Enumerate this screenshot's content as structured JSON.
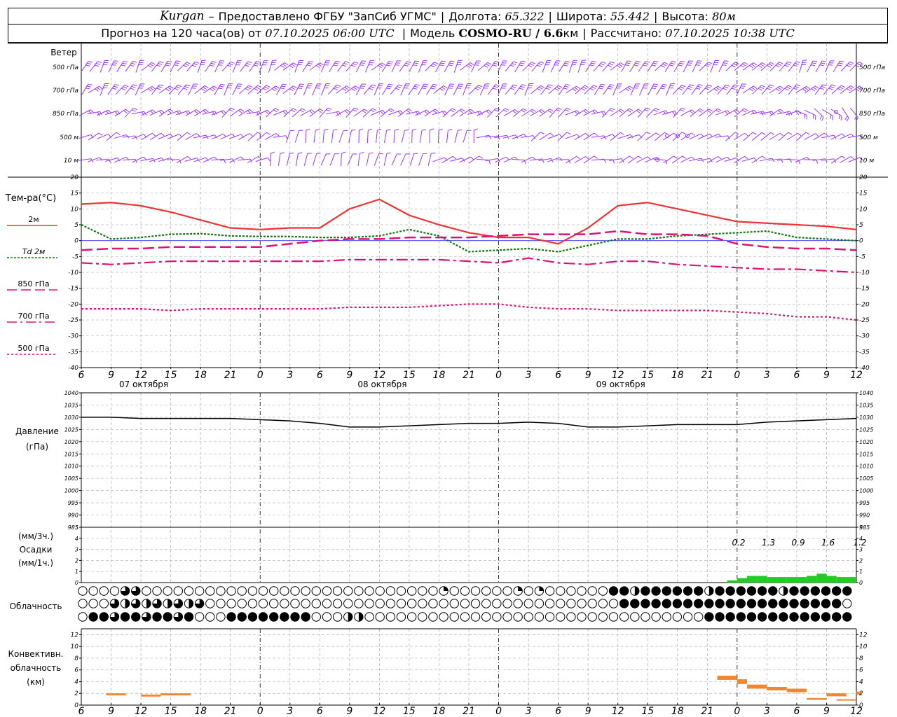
{
  "header": {
    "station": "Kurgan",
    "dash": "–",
    "provider": "Предоставлено ФГБУ \"ЗапСиб УГМС\"",
    "lon_label": "Долгота:",
    "lon": "65.322",
    "lat_label": "Широта:",
    "lat": "55.442",
    "alt_label": "Высота:",
    "alt": "80м",
    "forecast_text": "Прогноз на 120 часа(ов) от",
    "forecast_start": "07.10.2025 06:00 UTC",
    "model_label": "Модель",
    "model": "COSMO-RU / 6.6",
    "model_unit": "км",
    "calc_label": "Рассчитано:",
    "calc_time": "07.10.2025 10:38 UTC"
  },
  "wind": {
    "title": "Ветер",
    "levels": [
      "500 гПа",
      "700 гПа",
      "850 гПа",
      "500 м",
      "10 м"
    ],
    "color": "#9933ff"
  },
  "time_axis": {
    "ticks": [
      "6",
      "9",
      "12",
      "15",
      "18",
      "21",
      "0",
      "3",
      "6",
      "9",
      "12",
      "15",
      "18",
      "21",
      "0",
      "3",
      "6",
      "9",
      "12",
      "15",
      "18",
      "21",
      "0",
      "3",
      "6",
      "9",
      "12"
    ],
    "dates": [
      "07 октября",
      "08 октября",
      "09 октября"
    ]
  },
  "temperature": {
    "title": "Тем-ра(°С)",
    "legend": [
      "2м",
      "Td  2м",
      "850 гПа",
      "700 гПа",
      "500 гПа"
    ],
    "y_ticks": [
      "20",
      "15",
      "10",
      "5",
      "0",
      "-5",
      "-10",
      "-15",
      "-20",
      "-25",
      "-30",
      "-35",
      "-40"
    ]
  },
  "pressure": {
    "title": "Давление",
    "unit": "(гПа)",
    "y_ticks": [
      "1040",
      "1035",
      "1030",
      "1025",
      "1020",
      "1015",
      "1010",
      "1005",
      "1000",
      "995",
      "990",
      "985"
    ]
  },
  "precip": {
    "unit_3h": "(мм/3ч.)",
    "title": "Осадки",
    "unit_1h": "(мм/1ч.)",
    "y_ticks": [
      "5",
      "4",
      "3",
      "2",
      "1",
      "0"
    ],
    "totals": [
      "0.2",
      "1.3",
      "0.9",
      "1.6",
      "1.2"
    ]
  },
  "cloud": {
    "title": "Облачность"
  },
  "convective": {
    "title_line1": "Конвективн.",
    "title_line2": "облачность",
    "title_line3": "(км)",
    "y_ticks": [
      "12",
      "10",
      "8",
      "6",
      "4",
      "2",
      "0"
    ]
  },
  "colors": {
    "t2m": "#ee3333",
    "td2m": "#117711",
    "t850": "#dd1177",
    "t700": "#dd1177",
    "t500": "#dd1177",
    "precip": "#22cc22",
    "convective": "#ee8833",
    "wind": "#9933ff"
  },
  "chart_data": [
    {
      "type": "line",
      "name": "temperature",
      "x_hours": [
        6,
        9,
        12,
        15,
        18,
        21,
        24,
        27,
        30,
        33,
        36,
        39,
        42,
        45,
        48,
        51,
        54,
        57,
        60,
        63,
        66,
        69,
        72,
        75,
        78,
        81,
        84
      ],
      "series": [
        {
          "name": "2м",
          "values": [
            11.5,
            12,
            11,
            9,
            6.5,
            4,
            3.5,
            4,
            4,
            10,
            13,
            8,
            5,
            2.5,
            1,
            1,
            -1,
            4,
            11,
            12,
            10,
            8,
            6,
            5.5,
            5,
            4.5,
            3.5
          ]
        },
        {
          "name": "Td  2м",
          "values": [
            5,
            0.5,
            1,
            2,
            2.2,
            1.5,
            1.3,
            1.3,
            1,
            1,
            1.5,
            3.5,
            1.5,
            -3.5,
            -3,
            -2.5,
            -3.5,
            -1.5,
            0.5,
            0.5,
            1.5,
            2,
            2.5,
            3,
            1,
            0.5,
            0
          ]
        },
        {
          "name": "850 гПа",
          "values": [
            -3,
            -2.5,
            -2.5,
            -2,
            -2,
            -2,
            -2,
            -1,
            0,
            0.5,
            0.5,
            1,
            1,
            1,
            1.5,
            2,
            2,
            2,
            3,
            2,
            2,
            1.5,
            -1,
            -2,
            -2.5,
            -2.5,
            -3
          ]
        },
        {
          "name": "700 гПа",
          "values": [
            -7,
            -7.5,
            -7,
            -6.5,
            -6.5,
            -6.5,
            -6.5,
            -6.5,
            -6.5,
            -6,
            -6,
            -6,
            -6,
            -6.5,
            -7,
            -5.5,
            -7,
            -7.5,
            -6.5,
            -6.5,
            -7.5,
            -8,
            -8.5,
            -9,
            -9,
            -9.5,
            -10
          ]
        },
        {
          "name": "500 гПа",
          "values": [
            -21.5,
            -21.5,
            -21.5,
            -22,
            -21.5,
            -21.5,
            -21.5,
            -21.5,
            -21.5,
            -21,
            -21,
            -21,
            -20.5,
            -20,
            -20,
            -21,
            -21.5,
            -21.5,
            -22,
            -22,
            -22,
            -22,
            -22.5,
            -23,
            -24,
            -24,
            -25
          ]
        }
      ],
      "ylim": [
        -40,
        20
      ]
    },
    {
      "type": "line",
      "name": "pressure",
      "x_hours": [
        6,
        9,
        12,
        15,
        18,
        21,
        24,
        27,
        30,
        33,
        36,
        39,
        42,
        45,
        48,
        51,
        54,
        57,
        60,
        63,
        66,
        69,
        72,
        75,
        78,
        81,
        84
      ],
      "series": [
        {
          "values": [
            1030,
            1030,
            1029.5,
            1029.5,
            1029.5,
            1029.5,
            1029,
            1028.5,
            1027.5,
            1026,
            1026,
            1026.5,
            1027,
            1027.5,
            1027.5,
            1028,
            1027.5,
            1026,
            1026,
            1026.5,
            1027,
            1027,
            1027,
            1028,
            1028.5,
            1029,
            1029.5
          ]
        }
      ],
      "ylim": [
        985,
        1040
      ]
    },
    {
      "type": "bar",
      "name": "precipitation",
      "x_hours": [
        72,
        73,
        74,
        75,
        76,
        77,
        78,
        79,
        80,
        81,
        82,
        83,
        84
      ],
      "values": [
        0.2,
        0.4,
        0.6,
        0.6,
        0.5,
        0.5,
        0.5,
        0.5,
        0.6,
        0.8,
        0.6,
        0.5,
        0.5
      ],
      "ylim": [
        0,
        5
      ]
    },
    {
      "type": "bar",
      "name": "convective_clouds",
      "segments": [
        {
          "x0": 8.5,
          "x1": 10.5,
          "top": 2
        },
        {
          "x0": 12,
          "x1": 14,
          "top": 1.8
        },
        {
          "x0": 14,
          "x1": 17,
          "top": 2
        },
        {
          "x0": 70,
          "x1": 72,
          "top": 5,
          "bottom": 4.3
        },
        {
          "x0": 72,
          "x1": 73,
          "top": 4.4,
          "bottom": 3.6
        },
        {
          "x0": 73,
          "x1": 75,
          "top": 3.5,
          "bottom": 2.8
        },
        {
          "x0": 75,
          "x1": 77,
          "top": 3.1,
          "bottom": 2.5
        },
        {
          "x0": 77,
          "x1": 79,
          "top": 2.8,
          "bottom": 2.2
        },
        {
          "x0": 79,
          "x1": 81,
          "top": 1.2,
          "bottom": 0.9
        },
        {
          "x0": 81,
          "x1": 83,
          "top": 2,
          "bottom": 1.5
        },
        {
          "x0": 82,
          "x1": 84,
          "top": 1,
          "bottom": 0.8
        },
        {
          "x0": 84,
          "x1": 84.5,
          "top": 2.3,
          "bottom": 1.8
        }
      ],
      "ylim": [
        0,
        13
      ]
    }
  ]
}
